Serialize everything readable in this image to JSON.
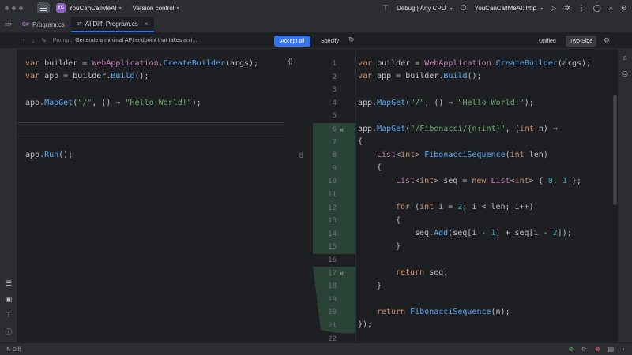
{
  "titlebar": {
    "project_badge": "YC",
    "project_name": "YouCanCallMeAI",
    "version_control": "Version control",
    "config": "Debug | Any CPU",
    "run_target": "YouCanCallMeAI: http"
  },
  "tabs": [
    {
      "label": "Program.cs"
    },
    {
      "label": "AI Diff: Program.cs"
    }
  ],
  "toolbar": {
    "prompt_label": "Prompt:",
    "prompt_text": "Generate a minimal API endpoint that takes an i...",
    "accept_all": "Accept all",
    "specify": "Specify",
    "mode_unified": "Unified",
    "mode_two_side": "Two-Side"
  },
  "status": {
    "diff_label": "Diff"
  },
  "left_code": [
    "var builder = WebApplication.CreateBuilder(args);",
    "var app = builder.Build();",
    "",
    "app.MapGet(\"/\", () => \"Hello World!\");",
    "",
    "",
    "app.Run();"
  ],
  "right_line_numbers": [
    "1",
    "2",
    "3",
    "4",
    "5",
    "6",
    "7",
    "8",
    "9",
    "10",
    "11",
    "12",
    "13",
    "14",
    "15",
    "16",
    "17",
    "18",
    "19",
    "20",
    "21",
    "22"
  ],
  "left_line_numbers": [
    "8"
  ],
  "colors": {
    "accent": "#3574f0",
    "added_bg": "#294436",
    "badge": "#8b5fc7"
  }
}
